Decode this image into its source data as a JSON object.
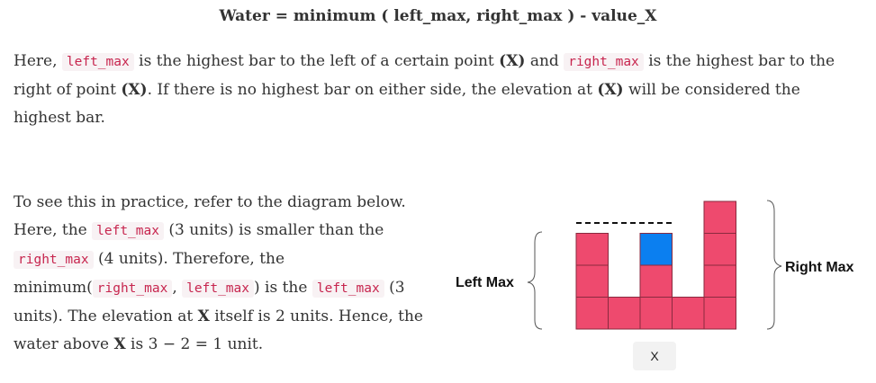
{
  "title": "Water = minimum ( left_max, right_max ) - value_X",
  "intro": {
    "t1": "Here, ",
    "code1": "left_max",
    "t2": " is the highest bar to the left of a certain point ",
    "b1": "(X)",
    "t3": " and ",
    "code2": "right_max",
    "t4": " is the highest bar to the right of point ",
    "b2": "(X)",
    "t5": ". If there is no highest bar on either side, the elevation at ",
    "b3": "(X)",
    "t6": " will be considered the highest bar."
  },
  "explain": {
    "t1": "To see this in practice, refer to the diagram below. Here, the ",
    "code1": "left_max",
    "t2": " (3 units) is smaller than the ",
    "code2": "right_max",
    "t3": " (4 units). Therefore, the minimum(",
    "code3": "right_max",
    "t4": ", ",
    "code4": "left_max",
    "t5": ") is the ",
    "code5": "left_max",
    "t6": " (3 units). The elevation at ",
    "b1": "X",
    "t7": " itself is 2 units. Hence, the water above ",
    "b2": "X",
    "t8": " is 3 − 2 = 1 unit."
  },
  "diagram": {
    "left_label": "Left Max",
    "right_label": "Right Max",
    "x_label": "X",
    "bar_heights": [
      3,
      1,
      2,
      1,
      4
    ],
    "water_column": 2,
    "water_units": 1,
    "colors": {
      "bar": "#ee4a6e",
      "water": "#0b7ff0",
      "border": "#8a2a3f",
      "dashes": "#111111"
    }
  }
}
